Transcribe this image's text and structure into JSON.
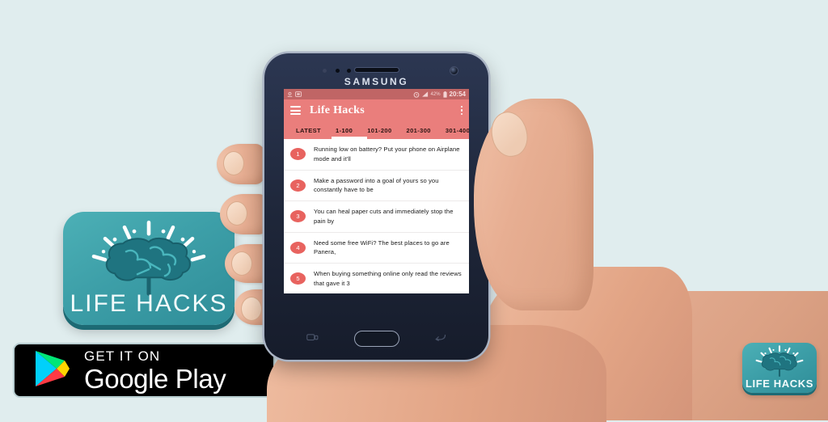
{
  "page": {
    "background_color": "#e0edee",
    "title": "Life Hacks app store listing graphic"
  },
  "app_icon": {
    "label": "LIFE HACKS",
    "graphic": "brain-icon",
    "background_color": "#3d9fa8",
    "accent_color": "#ffffff"
  },
  "app_icon_small": {
    "label": "LIFE HACKS",
    "graphic": "brain-icon"
  },
  "google_play_badge": {
    "pre_text": "GET IT ON",
    "store_name": "Google Play",
    "icon": "google-play-triangle-icon",
    "background_color": "#000000"
  },
  "phone": {
    "brand": "SAMSUNG",
    "body_color": "#1e2639",
    "home_button": "home-button",
    "recents_key": "recents-key",
    "back_key": "back-key"
  },
  "screen": {
    "statusbar": {
      "time": "20:54",
      "battery": "42%",
      "icons": [
        "location-icon",
        "sd-card-icon",
        "alarm-icon",
        "signal-icon",
        "battery-icon"
      ],
      "background_color": "#c06565"
    },
    "appbar": {
      "menu_icon": "hamburger-menu-icon",
      "title": "Life Hacks",
      "overflow_icon": "kebab-menu-icon",
      "background_color": "#ea7e7c"
    },
    "tabs": {
      "active_index": 1,
      "items": [
        {
          "label": "LATEST"
        },
        {
          "label": "1-100"
        },
        {
          "label": "101-200"
        },
        {
          "label": "201-300"
        },
        {
          "label": "301-400"
        }
      ]
    },
    "list": {
      "items": [
        {
          "number": "1",
          "text": "Running low on battery? Put your phone on Airplane mode and it'll"
        },
        {
          "number": "2",
          "text": "Make a password into a goal of yours so you constantly have to be"
        },
        {
          "number": "3",
          "text": "You can heal paper cuts and immediately stop the pain by"
        },
        {
          "number": "4",
          "text": "Need some free WiFi? The best places to go are Panera,"
        },
        {
          "number": "5",
          "text": "When buying something online only read the reviews that gave it 3"
        }
      ],
      "badge_color": "#e8635f"
    }
  }
}
